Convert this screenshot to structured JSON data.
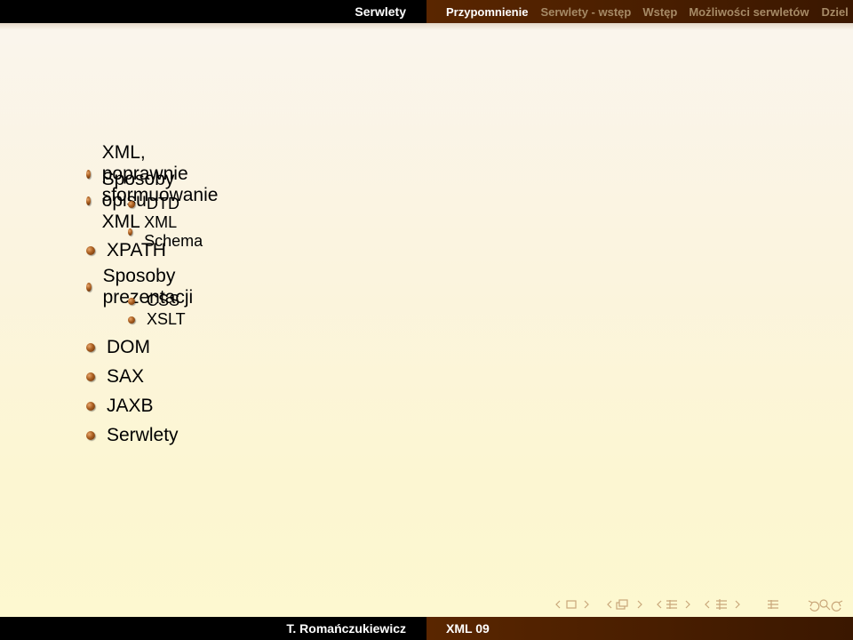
{
  "header": {
    "section_title": "Serwlety",
    "nav": [
      "Przypomnienie",
      "Serwlety - wstęp",
      "Wstęp",
      "Możliwości serwletów",
      "Dziel"
    ]
  },
  "slide": {
    "items": [
      {
        "level": 1,
        "text": "XML, poprawnie sformuowanie"
      },
      {
        "level": 1,
        "text": "Sposoby opisu XML"
      },
      {
        "level": 2,
        "text": "DTD"
      },
      {
        "level": 2,
        "text": "XML Schema"
      },
      {
        "level": 1,
        "text": "XPATH"
      },
      {
        "level": 1,
        "text": "Sposoby prezentacji"
      },
      {
        "level": 2,
        "text": "CSS"
      },
      {
        "level": 2,
        "text": "XSLT"
      },
      {
        "level": 1,
        "text": "DOM"
      },
      {
        "level": 1,
        "text": "SAX"
      },
      {
        "level": 1,
        "text": "JAXB"
      },
      {
        "level": 1,
        "text": "Serwlety"
      }
    ]
  },
  "footer": {
    "author": "T. Romańczukiewicz",
    "title": "XML 09"
  },
  "nav_symbols": [
    "frame-prev",
    "frame-icon",
    "frame-next",
    "subsection-prev",
    "subsection-icon",
    "subsection-next",
    "section-prev",
    "section-icon",
    "section-next",
    "presentation-prev",
    "presentation-icon",
    "presentation-next",
    "appendix-icon",
    "back-icon",
    "search-icon",
    "forward-icon"
  ],
  "colors": {
    "header_dark": "#000000",
    "header_brown": "#4a1f00",
    "nav_inactive": "#a68a66",
    "bullet": "#a85d1f"
  }
}
